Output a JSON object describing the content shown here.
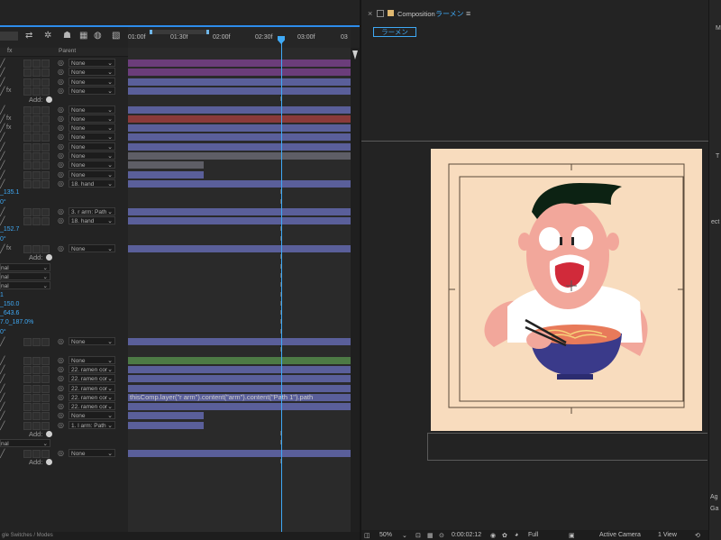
{
  "timeline": {
    "ruler_ticks": [
      "01:00f",
      "01:30f",
      "02:00f",
      "02:30f",
      "03:00f",
      "03"
    ],
    "parent_header": "Parent",
    "layer_rows": [
      {
        "parent": "None",
        "bar": "purple"
      },
      {
        "parent": "None",
        "bar": "purple"
      },
      {
        "parent": "None",
        "bar": "blue"
      },
      {
        "parent": "None",
        "bar": "blue",
        "fx": true
      },
      {
        "add": "Add:"
      },
      {
        "parent": "None",
        "bar": "blue"
      },
      {
        "parent": "None",
        "bar": "red",
        "fx": true
      },
      {
        "parent": "None",
        "bar": "blue",
        "fx": true
      },
      {
        "parent": "None",
        "bar": "blue"
      },
      {
        "parent": "None",
        "bar": "blue"
      },
      {
        "parent": "None",
        "bar": "grey"
      },
      {
        "parent": "None",
        "bar": "grey"
      },
      {
        "parent": "None",
        "bar": "blue"
      },
      {
        "parent": "18. hand",
        "bar": "blue"
      },
      {
        "value": "_135.1"
      },
      {
        "value": "0°"
      },
      {
        "parent": "3. r arm: Path",
        "bar": "blue"
      },
      {
        "parent": "18. hand",
        "bar": "blue"
      },
      {
        "value": "_152.7"
      },
      {
        "value": "0°"
      },
      {
        "parent": "None",
        "bar": "blue",
        "fx": true
      },
      {
        "add": "Add:"
      },
      {
        "normal": "nal"
      },
      {
        "normal": "nal"
      },
      {
        "normal": "nal"
      },
      {
        "value": "1"
      },
      {
        "value": "_150.0"
      },
      {
        "value": "_643.6"
      },
      {
        "value": "7.0_187.0%"
      },
      {
        "value": "0°"
      },
      {
        "parent": "None",
        "bar": "blue"
      },
      {
        "expression": "thisComp.layer(\"r arm\").content(\"arm\").content(\"Path 1\").path"
      },
      {
        "parent": "None",
        "bar": "green"
      },
      {
        "parent": "22. ramen cor",
        "bar": "blue"
      },
      {
        "parent": "22. ramen cor",
        "bar": "blue"
      },
      {
        "parent": "22. ramen cor",
        "bar": "blue"
      },
      {
        "parent": "22. ramen cor",
        "bar": "blue"
      },
      {
        "parent": "22. ramen cor",
        "bar": "blue"
      },
      {
        "parent": "None",
        "bar": "blue"
      },
      {
        "parent": "1. l arm: Path",
        "bar": "blue"
      },
      {
        "add": "Add:"
      },
      {
        "normal": "nal"
      },
      {
        "parent": "None",
        "bar": "blue"
      },
      {
        "add": "Add:"
      }
    ],
    "add_label": "Add:",
    "expression_text": "thisComp.layer(\"r arm\").content(\"arm\").content(\"Path 1\").path",
    "bottom_label": "gle Switches / Modes",
    "colors": {
      "purple": "#6b3d7a",
      "blue": "#5a5f9a",
      "red": "#8a3a3a",
      "grey": "#5e5e66",
      "green": "#4d7a45",
      "cti": "#3fa9f5"
    }
  },
  "composition": {
    "panel_label": "Composition",
    "name": "ラーメン",
    "subtab": "ラーメン",
    "footer": {
      "zoom": "50%",
      "timecode": "0:00:02:12",
      "resolution": "Full",
      "camera": "Active Camera",
      "view": "1 View"
    }
  },
  "right_panel": {
    "items": [
      "M",
      "T",
      "ect",
      "Ag",
      "Ga"
    ]
  }
}
